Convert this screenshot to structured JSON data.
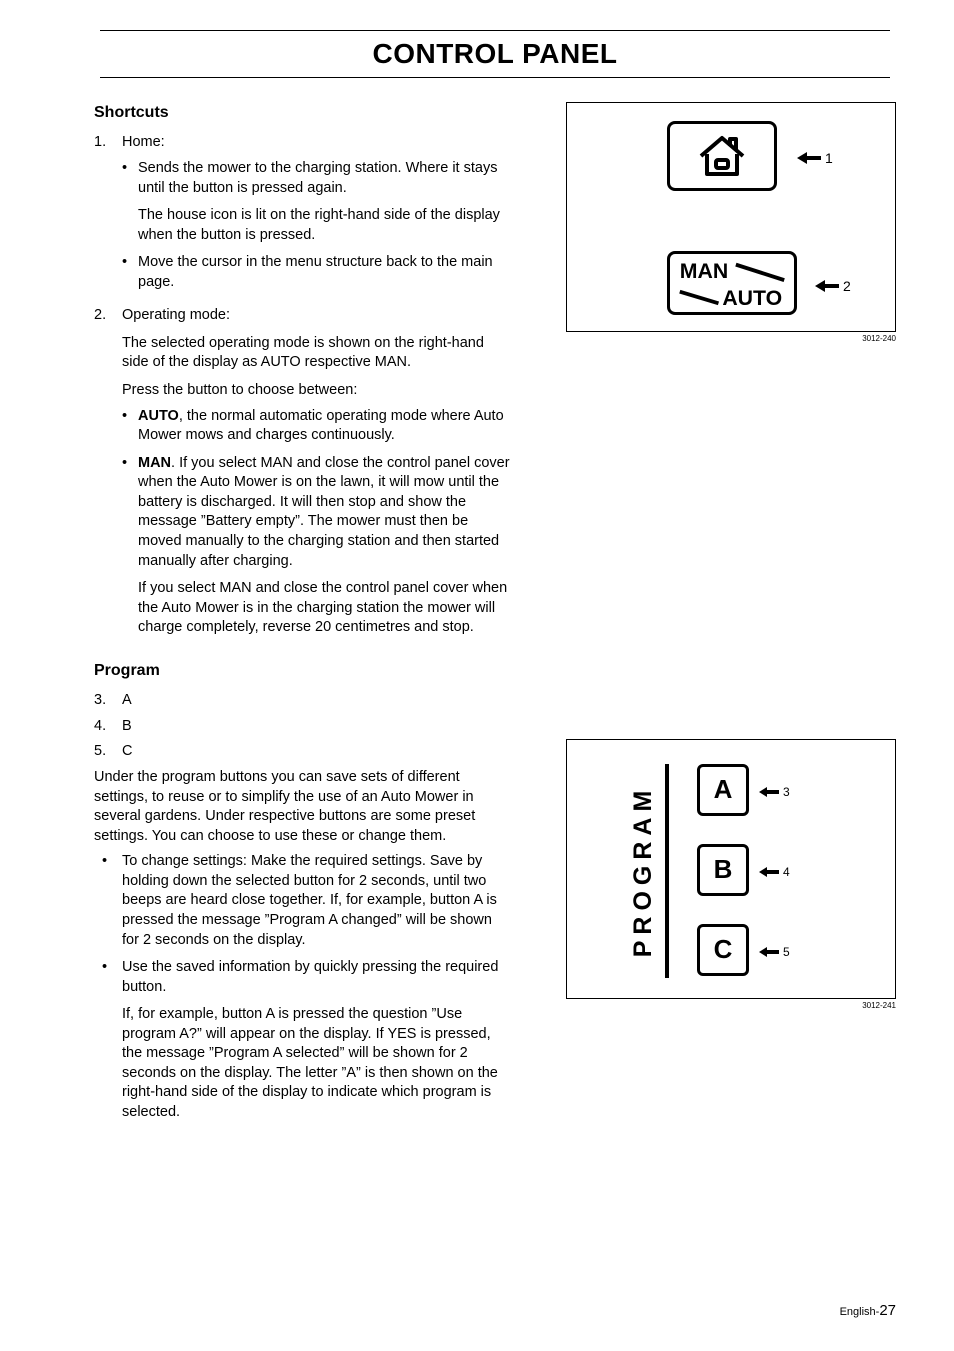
{
  "title": "CONTROL PANEL",
  "sections": {
    "shortcuts": {
      "heading": "Shortcuts",
      "items": [
        {
          "num": "1.",
          "label": "Home:",
          "bullets": [
            {
              "main": "Sends the mower to the charging station. Where it stays until the button is pressed again.",
              "after": "The house icon is lit on the right-hand side of the display when the button is pressed."
            },
            {
              "main": "Move the cursor in the menu structure back to the main page."
            }
          ]
        },
        {
          "num": "2.",
          "label": "Operating mode:",
          "paras": [
            "The selected operating mode is shown on the right-hand side of the display as AUTO respective MAN.",
            "Press the button to choose between:"
          ],
          "bullets2": [
            {
              "bold": "AUTO",
              "rest": ", the normal automatic operating mode where Auto Mower mows and charges continuously."
            },
            {
              "bold": "MAN",
              "rest": ". If you select MAN and close the control panel cover when the Auto Mower is on the lawn, it will mow until the battery is discharged. It will then stop and show the message ”Battery empty”. The mower must then be moved manually to the charging station and then started manually after charging.",
              "after": "If you select MAN and close the control panel cover when the Auto Mower is in the charging station the mower will charge completely, reverse 20 centimetres and stop."
            }
          ]
        }
      ]
    },
    "program": {
      "heading": "Program",
      "items": [
        {
          "num": "3.",
          "label": "A"
        },
        {
          "num": "4.",
          "label": "B"
        },
        {
          "num": "5.",
          "label": "C"
        }
      ],
      "intro": "Under the program buttons you can save sets of different settings, to reuse or to simplify the use of an Auto Mower in several gardens. Under respective buttons are some preset settings. You can choose to use these or change them.",
      "bullets": [
        {
          "main": "To change settings: Make the required settings. Save by holding down the selected button for 2 seconds, until two beeps are heard close together. If, for example, button A is pressed the message ”Program A changed” will be shown for 2 seconds on the display."
        },
        {
          "main": "Use the saved information by quickly pressing the required button.",
          "after": "If, for example, button A is pressed the question ”Use program A?” will appear on the display. If YES is pressed, the message ”Program A selected” will be shown for 2 seconds on the display. The letter ”A” is then shown on the right-hand side of the display to indicate which program is selected."
        }
      ]
    }
  },
  "figures": {
    "f1": {
      "code": "3012-240",
      "callout1": "1",
      "callout2": "2",
      "man": "MAN",
      "auto": "AUTO"
    },
    "f2": {
      "code": "3012-241",
      "label": "PROGRAM",
      "a": "A",
      "b": "B",
      "c": "C",
      "c3": "3",
      "c4": "4",
      "c5": "5"
    }
  },
  "footer": {
    "lang": "English-",
    "page": "27"
  }
}
